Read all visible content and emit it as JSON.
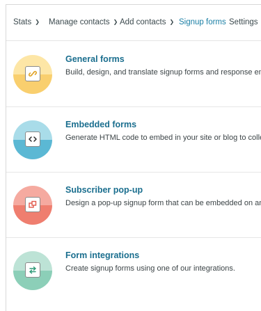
{
  "nav": {
    "items": [
      {
        "label": "Stats",
        "has_dropdown": true,
        "active": false
      },
      {
        "label": "Manage contacts",
        "has_dropdown": true,
        "active": false
      },
      {
        "label": "Add contacts",
        "has_dropdown": true,
        "active": false
      },
      {
        "label": "Signup forms",
        "has_dropdown": false,
        "active": true
      },
      {
        "label": "Settings",
        "has_dropdown": true,
        "active": false
      }
    ],
    "active_color": "#1a7fa5"
  },
  "forms": [
    {
      "title": "General forms",
      "description": "Build, design, and translate signup forms and response emails",
      "icon": "link-icon",
      "colors": {
        "top": "#fde6a6",
        "bottom": "#f9cf6e"
      }
    },
    {
      "title": "Embedded forms",
      "description": "Generate HTML code to embed in your site or blog to collect signups.",
      "icon": "code-icon",
      "colors": {
        "top": "#a9dce9",
        "bottom": "#5bb8d4"
      }
    },
    {
      "title": "Subscriber pop-up",
      "description": "Design a pop-up signup form that can be embedded on any site.",
      "icon": "popup-icon",
      "colors": {
        "top": "#f5aaa0",
        "bottom": "#ef7e6f"
      }
    },
    {
      "title": "Form integrations",
      "description": "Create signup forms using one of our integrations.",
      "icon": "swap-arrows-icon",
      "colors": {
        "top": "#bde3d6",
        "bottom": "#8ccfb8"
      }
    }
  ]
}
